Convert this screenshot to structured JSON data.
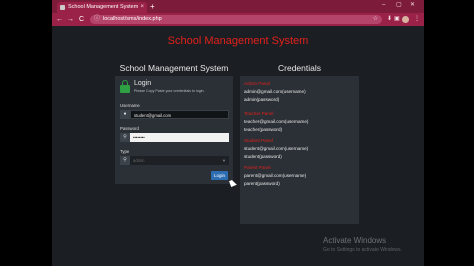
{
  "browser": {
    "tab_title": "School Management System",
    "tab_close": "×",
    "new_tab": "+",
    "window_controls": [
      "–",
      "▢",
      "✕"
    ],
    "nav": {
      "back": "←",
      "forward": "→",
      "reload": "C"
    },
    "url": "localhost/sms/index.php",
    "url_info_icon": "ⓘ",
    "bookmark_icon": "☆",
    "toolbar_icons": [
      "⬇",
      "▣",
      "⋮"
    ]
  },
  "page": {
    "main_title": "School Management System",
    "left_panel_title": "School Management System",
    "right_panel_title": "Credentials"
  },
  "login": {
    "heading": "Login",
    "subtitle": "Please Copy Paste your credentials to login.",
    "username_label": "Username",
    "username_value": "student@gmail.com",
    "password_label": "Password",
    "password_value": "••••••••",
    "type_label": "Type",
    "type_value": "admin",
    "button_label": "Login",
    "icons": {
      "user": "user-icon",
      "key": "key-icon",
      "type": "key-icon"
    },
    "lock_color": "#2ea043"
  },
  "credentials": [
    {
      "role": "Admin Panel",
      "email": "admin@gmail.com(username)",
      "password": "admin(password)"
    },
    {
      "role": "Teacher Panel",
      "email": "teacher@gmail.com(username)",
      "password": "teacher(password)"
    },
    {
      "role": "Student Panel",
      "email": "student@gmail.com(username)",
      "password": "student(password)"
    },
    {
      "role": "Parent Panel",
      "email": "parent@gmail.com(username)",
      "password": "parent(password)"
    }
  ],
  "watermark": {
    "line1": "Activate Windows",
    "line2": "Go to Settings to activate Windows."
  },
  "colors": {
    "accent_red": "#e3201b",
    "browser_frame": "#9a2248",
    "login_button": "#2d6eb3"
  }
}
